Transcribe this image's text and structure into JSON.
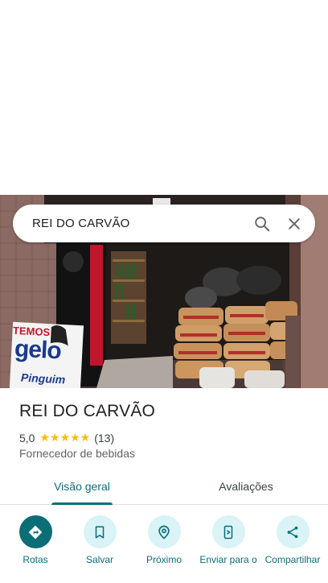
{
  "search": {
    "query": "REI DO CARVÃO"
  },
  "photo": {
    "sign_top": "TEMOS",
    "sign_main": "gelo",
    "sign_bottom": "Pinguim"
  },
  "place": {
    "name": "REI DO CARVÃO",
    "rating": "5,0",
    "stars": "★★★★★",
    "review_count": "(13)",
    "category": "Fornecedor de bebidas"
  },
  "tabs": [
    {
      "label": "Visão geral",
      "active": true
    },
    {
      "label": "Avaliações",
      "active": false
    }
  ],
  "actions": [
    {
      "label": "Rotas",
      "icon": "directions-icon"
    },
    {
      "label": "Salvar",
      "icon": "bookmark-icon"
    },
    {
      "label": "Próximo",
      "icon": "nearby-icon"
    },
    {
      "label": "Enviar para o",
      "icon": "send-to-phone-icon"
    },
    {
      "label": "Compartilhar",
      "icon": "share-icon"
    }
  ],
  "colors": {
    "accent": "#0b6e76",
    "star": "#fbbc04",
    "chip_bg": "#d9f3f6"
  }
}
